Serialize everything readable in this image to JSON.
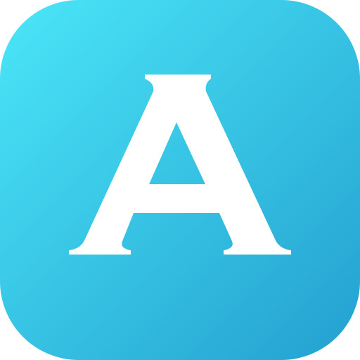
{
  "icon": {
    "glyph": "A",
    "glyph_color": "#ffffff",
    "gradient_start": "#4be6f8",
    "gradient_end": "#23a0d0",
    "shape": "rounded-square"
  }
}
